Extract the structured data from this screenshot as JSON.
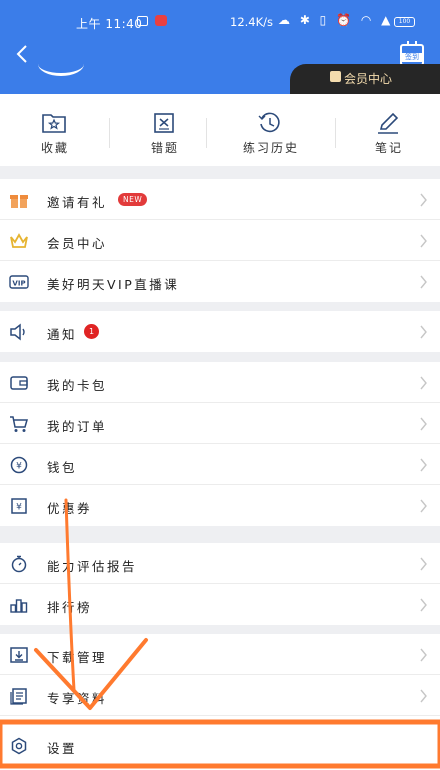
{
  "status_bar": {
    "time": "上午 11:40",
    "net_speed": "12.4K/s",
    "battery": "100"
  },
  "header": {
    "checkin_label": "签到",
    "member_tag": "会员中心"
  },
  "quick_actions": [
    {
      "label": "收藏",
      "icon": "folder-star-icon"
    },
    {
      "label": "错题",
      "icon": "wrong-question-icon"
    },
    {
      "label": "练习历史",
      "icon": "history-icon"
    },
    {
      "label": "笔记",
      "icon": "pencil-icon"
    }
  ],
  "menu": {
    "invite": {
      "label": "邀请有礼",
      "badge": "NEW"
    },
    "member": {
      "label": "会员中心"
    },
    "vip_live": {
      "label": "美好明天VIP直播课"
    },
    "notice": {
      "label": "通知",
      "badge": "1"
    },
    "cards": {
      "label": "我的卡包"
    },
    "orders": {
      "label": "我的订单"
    },
    "wallet": {
      "label": "钱包"
    },
    "coupon": {
      "label": "优惠券"
    },
    "report": {
      "label": "能力评估报告"
    },
    "ranking": {
      "label": "排行榜"
    },
    "download": {
      "label": "下载管理"
    },
    "materials": {
      "label": "专享资料"
    },
    "settings": {
      "label": "设置"
    }
  },
  "colors": {
    "primary": "#3b7de9",
    "badge_red": "#e23b3b",
    "annotation": "#ff7a2f"
  }
}
